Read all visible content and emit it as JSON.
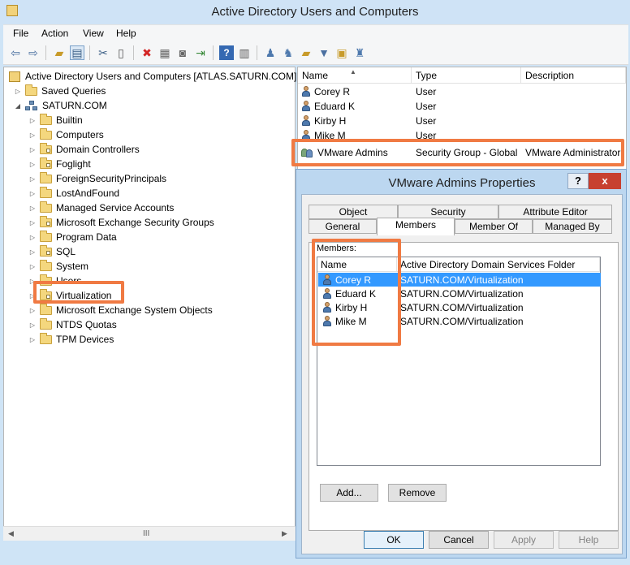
{
  "window": {
    "title": "Active Directory Users and Computers"
  },
  "menu": [
    "File",
    "Action",
    "View",
    "Help"
  ],
  "toolbar_icons": [
    "back-arrow-icon",
    "forward-arrow-icon",
    "up-folder-icon",
    "show-console-tree-icon",
    "cut-icon",
    "copy-icon",
    "delete-icon",
    "properties-icon",
    "refresh-icon",
    "export-list-icon",
    "help-icon",
    "action-pane-icon",
    "new-user-icon",
    "new-group-icon",
    "new-ou-icon",
    "filter-icon",
    "find-icon",
    "add-to-group-icon"
  ],
  "tree": {
    "root": "Active Directory Users and Computers [ATLAS.SATURN.COM]",
    "saved_queries": "Saved Queries",
    "domain": "SATURN.COM",
    "items": [
      "Builtin",
      "Computers",
      "Domain Controllers",
      "Foglight",
      "ForeignSecurityPrincipals",
      "LostAndFound",
      "Managed Service Accounts",
      "Microsoft Exchange Security Groups",
      "Program Data",
      "SQL",
      "System",
      "Users",
      "Virtualization",
      "Microsoft Exchange System Objects",
      "NTDS Quotas",
      "TPM Devices"
    ],
    "scroll_indicator": "III"
  },
  "list": {
    "columns": [
      "Name",
      "Type",
      "Description"
    ],
    "rows": [
      {
        "name": "Corey R",
        "type": "User",
        "description": ""
      },
      {
        "name": "Eduard K",
        "type": "User",
        "description": ""
      },
      {
        "name": "Kirby H",
        "type": "User",
        "description": ""
      },
      {
        "name": "Mike M",
        "type": "User",
        "description": ""
      },
      {
        "name": "VMware Admins",
        "type": "Security Group - Global",
        "description": "VMware Administrator"
      }
    ]
  },
  "dialog": {
    "title": "VMware Admins Properties",
    "help": "?",
    "close": "x",
    "tabs_row1": [
      "Object",
      "Security",
      "Attribute Editor"
    ],
    "tabs_row2": [
      "General",
      "Members",
      "Member Of",
      "Managed By"
    ],
    "members_label": "Members:",
    "columns": [
      "Name",
      "Active Directory Domain Services Folder"
    ],
    "members": [
      {
        "name": "Corey R",
        "folder": "SATURN.COM/Virtualization",
        "selected": true
      },
      {
        "name": "Eduard K",
        "folder": "SATURN.COM/Virtualization",
        "selected": false
      },
      {
        "name": "Kirby H",
        "folder": "SATURN.COM/Virtualization",
        "selected": false
      },
      {
        "name": "Mike M",
        "folder": "SATURN.COM/Virtualization",
        "selected": false
      }
    ],
    "buttons": {
      "add": "Add...",
      "remove": "Remove",
      "ok": "OK",
      "cancel": "Cancel",
      "apply": "Apply",
      "help": "Help"
    }
  },
  "colors": {
    "highlight": "#f07a43",
    "selection": "#3399ff",
    "window_frame": "#cfe3f6"
  }
}
